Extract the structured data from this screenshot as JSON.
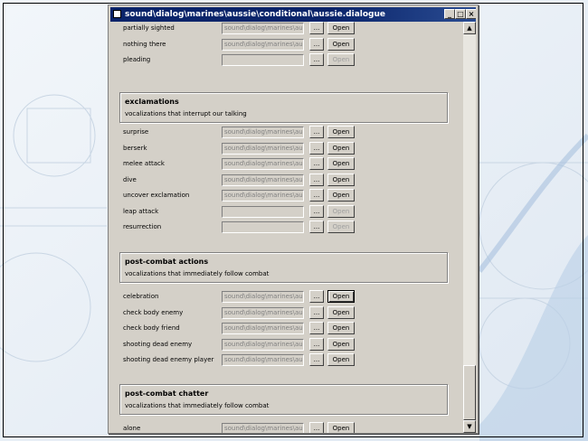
{
  "window": {
    "title": "sound\\dialog\\marines\\aussie\\conditional\\aussie.dialogue",
    "minimize": "_",
    "maximize": "□",
    "close": "×"
  },
  "common": {
    "browse_label": "...",
    "open_label": "Open",
    "path_value": "sound\\dialog\\marines\\aus",
    "scroll_up": "▲",
    "scroll_down": "▼"
  },
  "top_rows": [
    {
      "label": "partially sighted",
      "has_path": true
    },
    {
      "label": "nothing there",
      "has_path": true
    },
    {
      "label": "pleading",
      "has_path": false
    }
  ],
  "groups": [
    {
      "title": "exclamations",
      "description": "vocalizations that interrupt our talking",
      "rows": [
        {
          "label": "surprise",
          "has_path": true
        },
        {
          "label": "berserk",
          "has_path": true
        },
        {
          "label": "melee attack",
          "has_path": true
        },
        {
          "label": "dive",
          "has_path": true
        },
        {
          "label": "uncover exclamation",
          "has_path": true
        },
        {
          "label": "leap attack",
          "has_path": false
        },
        {
          "label": "resurrection",
          "has_path": false
        }
      ]
    },
    {
      "title": "post-combat actions",
      "description": "vocalizations that immediately follow combat",
      "rows": [
        {
          "label": "celebration",
          "has_path": true,
          "focused": true
        },
        {
          "label": "check body enemy",
          "has_path": true
        },
        {
          "label": "check body friend",
          "has_path": true
        },
        {
          "label": "shooting dead enemy",
          "has_path": true
        },
        {
          "label": "shooting dead enemy player",
          "has_path": true
        }
      ]
    },
    {
      "title": "post-combat chatter",
      "description": "vocalizations that immediately follow combat",
      "rows": [
        {
          "label": "alone",
          "has_path": true
        }
      ]
    }
  ]
}
